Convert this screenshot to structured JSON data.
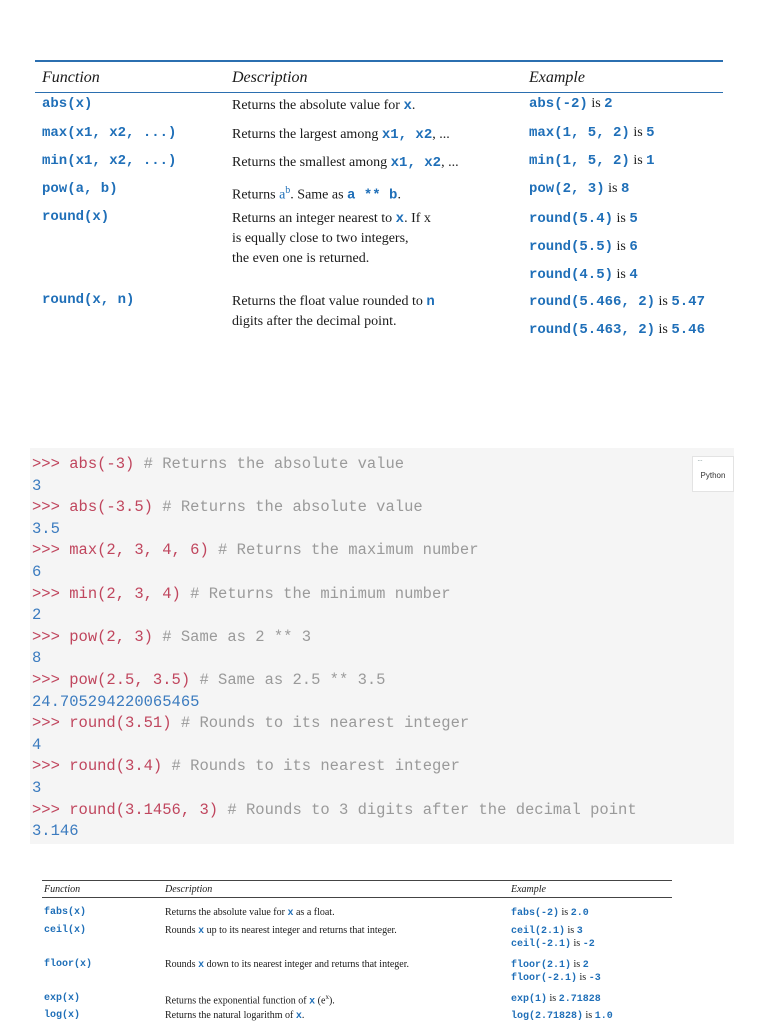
{
  "table1": {
    "headers": {
      "function": "Function",
      "description": "Description",
      "example": "Example"
    },
    "rows": [
      {
        "fn": "abs(x)",
        "desc": [
          [
            "Returns the absolute value for ",
            "x",
            "."
          ]
        ],
        "examples": [
          [
            "abs(-2)",
            " is ",
            "2"
          ]
        ]
      },
      {
        "fn": "max(x1, x2, ...)",
        "desc": [
          [
            "Returns the largest among ",
            "x1, x2",
            ", ..."
          ]
        ],
        "examples": [
          [
            "max(1, 5, 2)",
            " is ",
            "5"
          ]
        ]
      },
      {
        "fn": "min(x1, x2, ...)",
        "desc": [
          [
            "Returns the smallest among ",
            "x1, x2",
            ", ..."
          ]
        ],
        "examples": [
          [
            "min(1, 5, 2)",
            " is ",
            "1"
          ]
        ]
      },
      {
        "fn": "pow(a, b)",
        "desc_pow": {
          "pre": "Returns ",
          "a": "a",
          "sup": "b",
          "mid": ". Same as ",
          "expr": "a ** b",
          "end": "."
        },
        "examples": [
          [
            "pow(2, 3)",
            " is ",
            "8"
          ]
        ]
      },
      {
        "fn": "round(x)",
        "desc": [
          [
            "Returns an integer nearest to ",
            "x",
            ". If x"
          ],
          [
            "is equally close to two integers,",
            "",
            ""
          ],
          [
            "the even one is returned.",
            "",
            ""
          ]
        ],
        "examples": [
          [
            "round(5.4)",
            " is ",
            "5"
          ],
          [
            "round(5.5)",
            " is ",
            "6"
          ],
          [
            "round(4.5)",
            " is ",
            "4"
          ]
        ]
      },
      {
        "fn": "round(x, n)",
        "desc": [
          [
            "Returns the float value rounded to ",
            "n",
            ""
          ],
          [
            "digits after the decimal point.",
            "",
            ""
          ]
        ],
        "examples": [
          [
            "round(5.466, 2)",
            " is ",
            "5.47"
          ],
          [
            "round(5.463, 2)",
            " is ",
            "5.46"
          ]
        ]
      }
    ]
  },
  "console": {
    "badge_label": "Python",
    "lines": [
      {
        "type": "in",
        "prompt": ">>> ",
        "code": "abs(-3) ",
        "comment": "# Returns the absolute value"
      },
      {
        "type": "out",
        "text": "3"
      },
      {
        "type": "in",
        "prompt": ">>> ",
        "code": "abs(-3.5) ",
        "comment": "# Returns the absolute value"
      },
      {
        "type": "out",
        "text": "3.5"
      },
      {
        "type": "in",
        "prompt": ">>> ",
        "code": "max(2, 3, 4, 6) ",
        "comment": "# Returns the maximum number"
      },
      {
        "type": "out",
        "text": "6"
      },
      {
        "type": "in",
        "prompt": ">>> ",
        "code": "min(2, 3, 4) ",
        "comment": "# Returns the minimum number"
      },
      {
        "type": "out",
        "text": "2"
      },
      {
        "type": "in",
        "prompt": ">>> ",
        "code": "pow(2, 3) ",
        "comment": "# Same as 2 ** 3"
      },
      {
        "type": "out",
        "text": "8"
      },
      {
        "type": "in",
        "prompt": ">>> ",
        "code": "pow(2.5, 3.5) ",
        "comment": "# Same as 2.5 ** 3.5"
      },
      {
        "type": "out",
        "text": "24.705294220065465"
      },
      {
        "type": "in",
        "prompt": ">>> ",
        "code": "round(3.51) ",
        "comment": "# Rounds to its nearest integer"
      },
      {
        "type": "out",
        "text": "4"
      },
      {
        "type": "in",
        "prompt": ">>> ",
        "code": "round(3.4) ",
        "comment": "# Rounds to its nearest integer"
      },
      {
        "type": "out",
        "text": "3"
      },
      {
        "type": "in",
        "prompt": ">>> ",
        "code": "round(3.1456, 3) ",
        "comment": "# Rounds to 3 digits after the decimal point"
      },
      {
        "type": "out",
        "text": "3.146"
      }
    ]
  },
  "table2": {
    "headers": {
      "function": "Function",
      "description": "Description",
      "example": "Example"
    },
    "rows": [
      {
        "fn": "fabs(x)",
        "desc": [
          [
            "Returns the absolute value for ",
            "x",
            " as a float."
          ]
        ],
        "examples": [
          [
            "fabs(-2)",
            " is ",
            "2.0"
          ]
        ]
      },
      {
        "fn": "ceil(x)",
        "desc": [
          [
            "Rounds ",
            "x",
            " up to its nearest integer and returns that integer."
          ]
        ],
        "examples": [
          [
            "ceil(2.1)",
            " is ",
            "3"
          ],
          [
            "ceil(-2.1)",
            " is ",
            "-2"
          ]
        ]
      },
      {
        "fn": "floor(x)",
        "desc": [
          [
            "Rounds ",
            "x",
            " down to its nearest integer and returns that integer."
          ]
        ],
        "examples": [
          [
            "floor(2.1)",
            " is ",
            "2"
          ],
          [
            "floor(-2.1)",
            " is ",
            "-3"
          ]
        ]
      },
      {
        "fn": "exp(x)",
        "desc_exp": {
          "pre": "Returns the exponential function of ",
          "x": "x",
          "paren_open": " (",
          "e": "e",
          "sup": "x",
          "paren_close": ")."
        },
        "examples": [
          [
            "exp(1)",
            " is ",
            "2.71828"
          ]
        ]
      },
      {
        "fn": "log(x)",
        "desc": [
          [
            "Returns the natural logarithm of ",
            "x",
            "."
          ]
        ],
        "examples": [
          [
            "log(2.71828)",
            " is ",
            "1.0"
          ]
        ]
      }
    ]
  }
}
